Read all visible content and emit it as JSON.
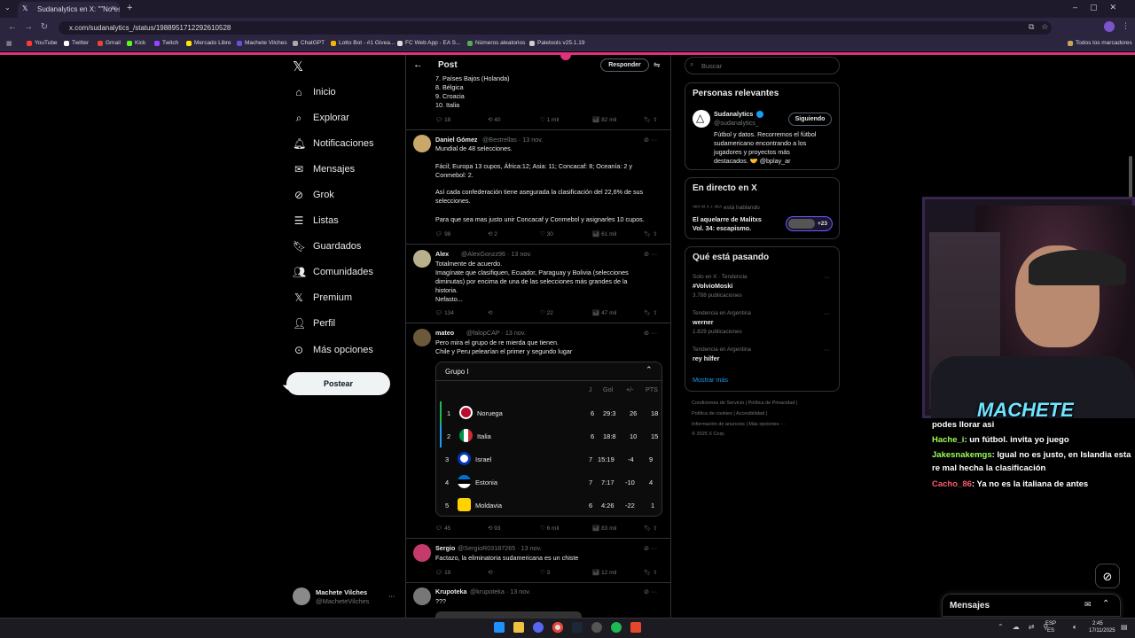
{
  "browser": {
    "tab_title": "Sudanalytics en X: \"\"No es justo...",
    "url": "x.com/sudanalytics_/status/1988951712292610528",
    "bookmarks": [
      "YouTube",
      "Twitter",
      "Gmail",
      "Kick",
      "Twitch",
      "Mercado Libre",
      "Machete Vilches",
      "ChatGPT",
      "Lotto Bot - #1 Givea...",
      "FC Web App - EA S...",
      "Números aleatorios",
      "Paletools v25.1.19"
    ],
    "bookmarks_right": "Todos los marcadores"
  },
  "left_nav": {
    "items": [
      "Inicio",
      "Explorar",
      "Notificaciones",
      "Mensajes",
      "Grok",
      "Listas",
      "Guardados",
      "Comunidades",
      "Premium",
      "Perfil",
      "Más opciones"
    ],
    "post_button": "Postear",
    "user_name": "Machete Vilches",
    "user_handle": "@MacheteVilches",
    "more": "···"
  },
  "center": {
    "header": "Post",
    "reply_button": "Responder",
    "list_top": [
      "7. Países Bajos (Holanda)",
      "8. Bélgica",
      "9. Croacia",
      "10. Italia"
    ],
    "first_actions": [
      "18",
      "40",
      "1 mil",
      "82 mil"
    ],
    "replies": [
      {
        "name": "Daniel Gómez",
        "handle": "@Bestrellas · 13 nov.",
        "lines": [
          "Mundial de 48 selecciones.",
          "",
          "Fácil; Europa 13 cupos, África:12; Asia: 11; Concacaf: 8; Oceanía: 2 y",
          "Conmebol: 2.",
          "",
          "Así cada confederación tiene asegurada la clasificación del 22,6% de sus",
          "selecciones.",
          "",
          "Para que sea mas justo unir Concacaf y Conmebol y asignarles 10 cupos."
        ],
        "actions": [
          "98",
          "2",
          "30",
          "61 mil"
        ]
      },
      {
        "name": "Alex",
        "handle": "@AlexGonzz96 · 13 nov.",
        "lines": [
          "Totalmente de acuerdo.",
          "Imagínate que clasifiquen, Ecuador, Paraguay y Bolivia (selecciones",
          "diminutas) por encima de una de las selecciones más grandes de la",
          "historia.",
          "Nefasto..."
        ],
        "actions": [
          "134",
          "",
          "22",
          "47 mil"
        ]
      },
      {
        "name": "mateo",
        "handle": "@falopCAP · 13 nov.",
        "lines": [
          "Pero mira el grupo de re mierda que tienen.",
          "Chile y Peru pelearían el primer y segundo lugar"
        ],
        "actions": [
          "45",
          "93",
          "6 mil",
          "83 mil"
        ]
      },
      {
        "name": "Sergio",
        "handle": "@SergioR03187265 · 13 nov.",
        "lines": [
          "Factazo, la eliminatoria sudamericana es un chiste"
        ],
        "actions": [
          "19",
          "",
          "3",
          "12 mil"
        ]
      },
      {
        "name": "Krupoteka",
        "handle": "@krupoteka · 13 nov.",
        "lines": [
          "???"
        ],
        "actions": []
      }
    ],
    "group": {
      "title": "Grupo I",
      "headers": [
        "J",
        "Gol",
        "+/-",
        "PTS"
      ],
      "rows": [
        {
          "pos": "1",
          "team": "Noruega",
          "j": "6",
          "gol": "29:3",
          "diff": "26",
          "pts": "18"
        },
        {
          "pos": "2",
          "team": "Italia",
          "j": "6",
          "gol": "18:8",
          "diff": "10",
          "pts": "15"
        },
        {
          "pos": "3",
          "team": "Israel",
          "j": "7",
          "gol": "15:19",
          "diff": "-4",
          "pts": "9"
        },
        {
          "pos": "4",
          "team": "Estonia",
          "j": "7",
          "gol": "7:17",
          "diff": "-10",
          "pts": "4"
        },
        {
          "pos": "5",
          "team": "Moldavia",
          "j": "6",
          "gol": "4:26",
          "diff": "-22",
          "pts": "1"
        }
      ]
    }
  },
  "right": {
    "search_placeholder": "Buscar",
    "relevant_title": "Personas relevantes",
    "relevant_name": "Sudanalytics",
    "relevant_handle": "@sudanalytics_",
    "following": "Siguiendo",
    "relevant_bio": [
      "Fútbol y datos. Recorremos el fútbol",
      "sudamericano encontrando a los",
      "jugadores y proyectos más",
      "destacados. 🤝 @bplay_ar"
    ],
    "live_title": "En directo en X",
    "live_host": "ᴬᴷᴬ ᴹ ᴬ ᶻ ᴬᴷᴬ está hablando",
    "live_name_1": "El aquelarre de Malitxs",
    "live_name_2": "Vol. 34: escapismo.",
    "live_count": "+23",
    "trends_title": "Qué está pasando",
    "trends": [
      {
        "meta": "Solo en X · Tendencia",
        "name": "#VolvioMoski",
        "count": "3.788 publicaciones"
      },
      {
        "meta": "Tendencia en Argentina",
        "name": "werner",
        "count": "1.829 publicaciones"
      },
      {
        "meta": "Tendencia en Argentina",
        "name": "rey hilfer",
        "count": ""
      }
    ],
    "show_more": "Mostrar más",
    "footer": [
      "Condiciones de Servicio | Política de Privacidad |",
      "Política de cookies | Accesibilidad |",
      "Información de anuncios | Más opciones ···",
      "© 2025 X Corp."
    ]
  },
  "stream": {
    "overlay_name": "MACHETE",
    "chat": [
      {
        "user": "",
        "text": "podes llorar asi"
      },
      {
        "user": "Hache_i",
        "text": ": un fútbol. invita yo juego",
        "color": "#9cff5a"
      },
      {
        "user": "Jakesnakemgs",
        "text": ": Igual no es justo, en Islandia esta",
        "color": "#9cff5a"
      },
      {
        "user": "",
        "text": "re mal hecha la clasificación"
      },
      {
        "user": "Cacho_86",
        "text": ": Ya no es la italiana de antes",
        "color": "#ff5a6a"
      }
    ]
  },
  "messages_dock": "Mensajes",
  "taskbar": {
    "lang": "ESP",
    "lang2": "ES",
    "time": "2:45",
    "date": "17/11/2025"
  }
}
